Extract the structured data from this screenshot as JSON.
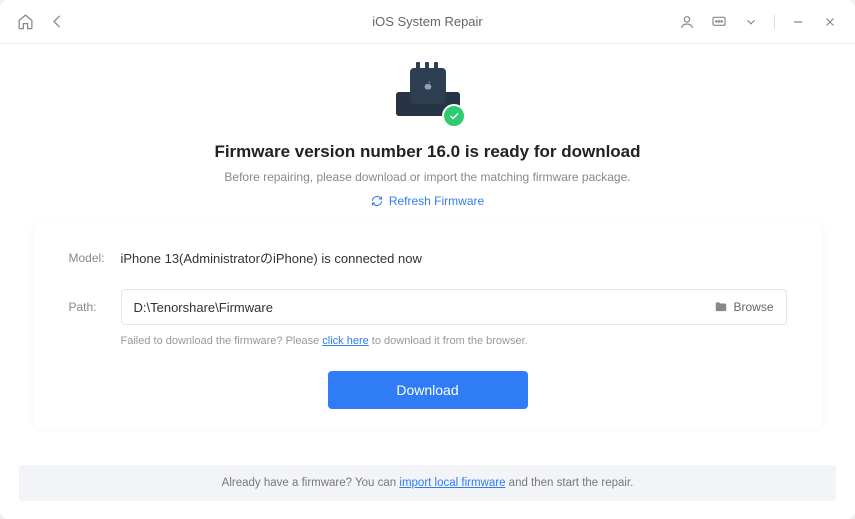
{
  "titlebar": {
    "title": "iOS System Repair"
  },
  "hero": {
    "headline": "Firmware version number 16.0 is ready for download",
    "subhead": "Before repairing, please download or import the matching firmware package.",
    "refresh_label": "Refresh Firmware"
  },
  "panel": {
    "model_label": "Model:",
    "model_value": "iPhone 13(AdministratorのiPhone) is connected now",
    "path_label": "Path:",
    "path_value": "D:\\Tenorshare\\Firmware",
    "browse_label": "Browse",
    "hint_prefix": "Failed to download the firmware? Please ",
    "hint_link": "click here",
    "hint_suffix": " to download it from the browser.",
    "download_label": "Download"
  },
  "footer": {
    "prefix": "Already have a firmware? You can ",
    "link": "import local firmware",
    "suffix": " and then start the repair."
  }
}
